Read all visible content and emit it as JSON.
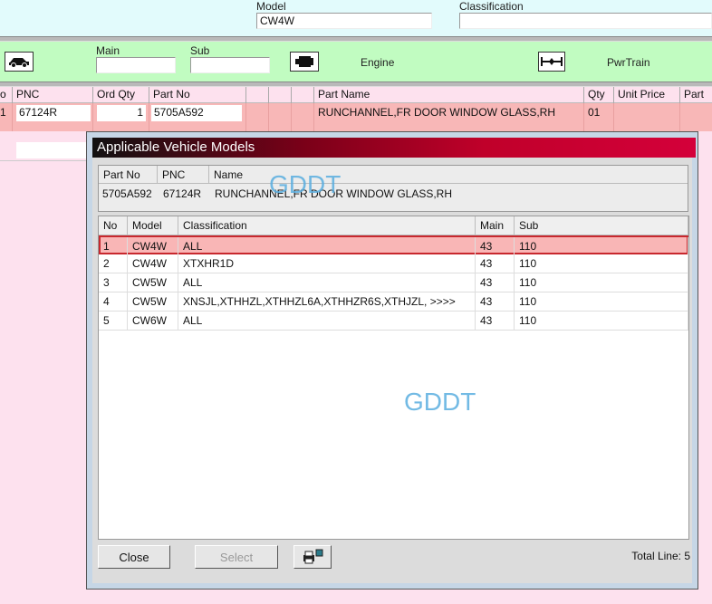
{
  "header": {
    "model_label": "Model",
    "model_value": "CW4W",
    "classification_label": "Classification",
    "classification_value": ""
  },
  "toolbar": {
    "car_icon": "car-icon",
    "main_label": "Main",
    "main_value": "",
    "sub_label": "Sub",
    "sub_value": "",
    "engine_icon": "engine-icon",
    "engine_label": "Engine",
    "powertrain_icon": "axle-icon",
    "powertrain_label": "PwrTrain"
  },
  "parts_table": {
    "columns": [
      "o",
      "PNC",
      "Ord Qty",
      "Part No",
      "",
      "",
      "",
      "Part Name",
      "Qty",
      "Unit Price",
      "Part"
    ],
    "rows": [
      {
        "no": "1",
        "pnc": "67124R",
        "ord_qty": "1",
        "part_no": "5705A592",
        "part_name": "RUNCHANNEL,FR DOOR WINDOW GLASS,RH",
        "qty": "01",
        "unit_price": "",
        "part": ""
      }
    ]
  },
  "dialog": {
    "title": "Applicable Vehicle Models",
    "info": {
      "headers": [
        "Part No",
        "PNC",
        "Name"
      ],
      "part_no": "5705A592",
      "pnc": "67124R",
      "name": "RUNCHANNEL,FR DOOR WINDOW GLASS,RH"
    },
    "grid": {
      "headers": [
        "No",
        "Model",
        "Classification",
        "Main",
        "Sub"
      ],
      "rows": [
        {
          "no": "1",
          "model": "CW4W",
          "classification": "ALL",
          "main": "43",
          "sub": "110"
        },
        {
          "no": "2",
          "model": "CW4W",
          "classification": "XTXHR1D",
          "main": "43",
          "sub": "110"
        },
        {
          "no": "3",
          "model": "CW5W",
          "classification": "ALL",
          "main": "43",
          "sub": "110"
        },
        {
          "no": "4",
          "model": "CW5W",
          "classification": "XNSJL,XTHHZL,XTHHZL6A,XTHHZR6S,XTHJZL,  >>>>",
          "main": "43",
          "sub": "110"
        },
        {
          "no": "5",
          "model": "CW6W",
          "classification": "ALL",
          "main": "43",
          "sub": "110"
        }
      ],
      "selected_index": 0
    },
    "close_label": "Close",
    "select_label": "Select",
    "print_icon": "printer-icon",
    "total_line": "Total Line: 5"
  },
  "watermark": "GDDT",
  "colors": {
    "title_gradient_end": "#d4003a",
    "selected_row": "#f9b6b6",
    "green_band": "#c1fcc1",
    "pink": "#fde1ee"
  }
}
